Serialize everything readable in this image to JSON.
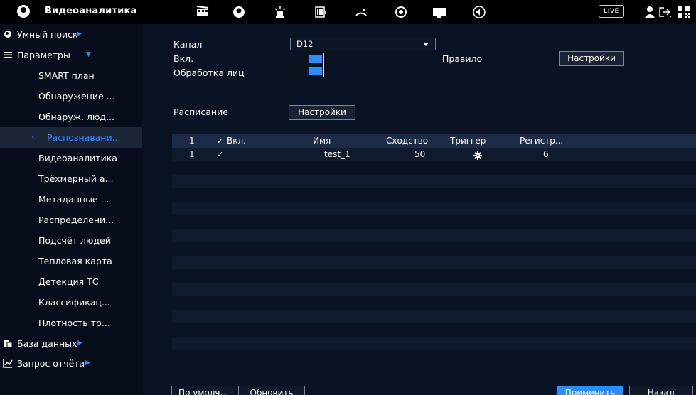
{
  "header": {
    "title": "Видеоаналитика",
    "live_label": "LIVE",
    "icons": [
      "film-icon",
      "face-icon",
      "alarm-light-icon",
      "storage-icon",
      "network-icon",
      "camera-lens-icon",
      "monitor-icon",
      "audio-icon",
      "user-icon",
      "logout-icon",
      "qr-code-icon"
    ]
  },
  "sidebar": {
    "top_items": [
      {
        "label": "Умный поиск",
        "icon": "smart-search-icon"
      },
      {
        "label": "Параметры",
        "icon": "list-icon"
      }
    ],
    "sub_items": [
      {
        "label": "SMART план"
      },
      {
        "label": "Обнаружение ..."
      },
      {
        "label": "Обнаруж. люд..."
      },
      {
        "label": "Распознавани..."
      },
      {
        "label": "Видеоаналитика"
      },
      {
        "label": "Трёхмерный а..."
      },
      {
        "label": "Метаданные ..."
      },
      {
        "label": "Распределени..."
      },
      {
        "label": "Подсчёт людей"
      },
      {
        "label": "Тепловая карта"
      },
      {
        "label": "Детекция ТС"
      },
      {
        "label": "Классификац..."
      },
      {
        "label": "Плотность тр..."
      }
    ],
    "bottom_items": [
      {
        "label": "База данных",
        "icon": "database-icon"
      },
      {
        "label": "Запрос отчёта",
        "icon": "report-icon"
      }
    ]
  },
  "form": {
    "channel_label": "Канал",
    "channel_value": "D12",
    "enable_label": "Вкл.",
    "face_label": "Обработка лиц",
    "rule_label": "Правило",
    "rule_button": "Настройки",
    "schedule_label": "Расписание",
    "schedule_button": "Настройки"
  },
  "table": {
    "headers": {
      "num": "1",
      "enable": "Вкл.",
      "name": "Имя",
      "similarity": "Сходство",
      "trigger": "Триггер",
      "register": "Регистр..."
    },
    "rows": [
      {
        "num": "1",
        "name": "test_1",
        "similarity": "50",
        "register": "6"
      }
    ]
  },
  "footer": {
    "default_button": "По умолч...",
    "refresh_button": "Обновить",
    "apply_button": "Применить",
    "back_button": "Назад"
  },
  "colors": {
    "accent": "#2b8dff",
    "background": "#0a1324",
    "sidebar": "#080d1c",
    "topbar": "#000000"
  }
}
